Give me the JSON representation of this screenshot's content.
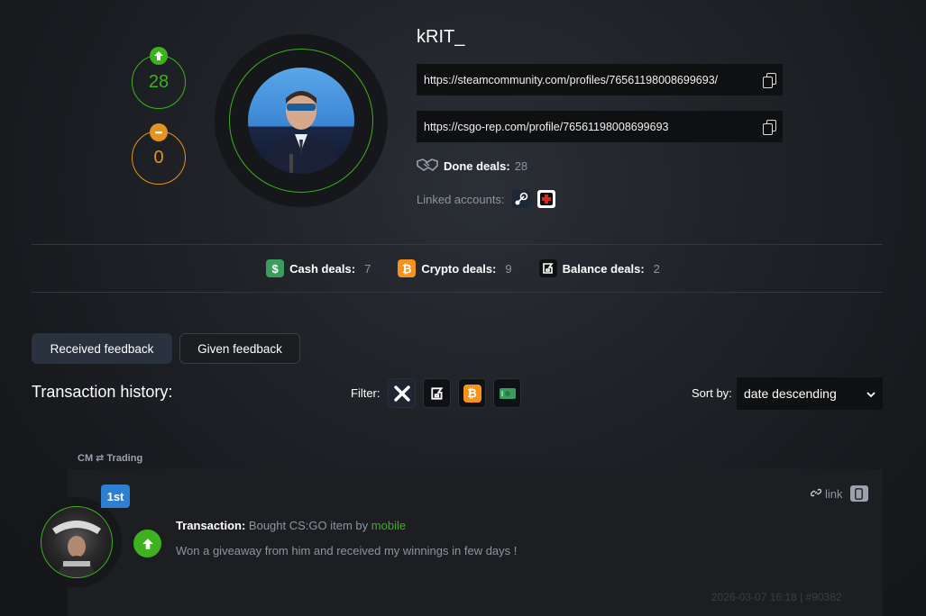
{
  "profile": {
    "username": "kRIT_",
    "rep_positive": "28",
    "rep_negative": "0",
    "steam_url": "https://steamcommunity.com/profiles/76561198008699693/",
    "rep_url": "https://csgo-rep.com/profile/76561198008699693",
    "done_deals_label": "Done deals:",
    "done_deals_value": "28",
    "linked_accounts_label": "Linked accounts:",
    "linked_accounts": [
      "steam-icon",
      "medical-cross-icon"
    ]
  },
  "deals": [
    {
      "icon": "dollar-icon",
      "label": "Cash deals:",
      "value": "7",
      "color": "#3a9d5d"
    },
    {
      "icon": "bitcoin-icon",
      "label": "Crypto deals:",
      "value": "9",
      "color": "#f7931a"
    },
    {
      "icon": "balance-icon",
      "label": "Balance deals:",
      "value": "2",
      "color": "#0f1012"
    }
  ],
  "tabs": {
    "received": "Received feedback",
    "given": "Given feedback"
  },
  "history": {
    "title": "Transaction history:",
    "filter_label": "Filter:",
    "filters": [
      "close-icon",
      "balance-icon",
      "bitcoin-icon",
      "cash-icon"
    ],
    "sort_label": "Sort by:",
    "sort_value": "date descending"
  },
  "feedback": {
    "section_label": "CM ⇄ Trading",
    "badge": "1st",
    "transaction_label": "Transaction:",
    "transaction_desc": "Bought CS:GO item by",
    "transaction_by": "mobile",
    "comment": "Won a giveaway from him and received my winnings in few days !",
    "link_label": "link",
    "meta": "2026-03-07 16:18 | #90382"
  },
  "colors": {
    "positive": "#3db21e",
    "negative": "#e6921e",
    "accent_blue": "#2f7fd1"
  }
}
